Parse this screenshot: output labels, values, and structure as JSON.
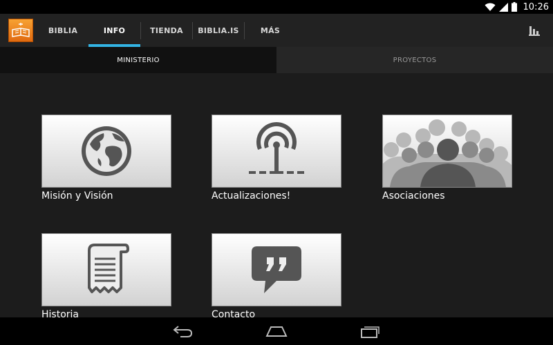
{
  "status": {
    "time": "10:26"
  },
  "app": {
    "icon": "bible-app-icon",
    "tabs": [
      {
        "label": "BIBLIA",
        "active": false
      },
      {
        "label": "INFO",
        "active": true
      },
      {
        "label": "TIENDA",
        "active": false
      },
      {
        "label": "BIBLIA.IS",
        "active": false
      },
      {
        "label": "MÁS",
        "active": false
      }
    ],
    "overflow_icon": "bar-chart-icon"
  },
  "subtabs": [
    {
      "label": "MINISTERIO",
      "active": true
    },
    {
      "label": "PROYECTOS",
      "active": false
    }
  ],
  "tiles": [
    {
      "label": "Misión y Visión",
      "icon": "globe-icon"
    },
    {
      "label": "Actualizaciones!",
      "icon": "broadcast-icon"
    },
    {
      "label": "Asociaciones",
      "icon": "people-icon"
    },
    {
      "label": "Historia",
      "icon": "scroll-icon"
    },
    {
      "label": "Contacto",
      "icon": "quote-bubble-icon"
    }
  ],
  "nav": {
    "back": "back-icon",
    "home": "home-icon",
    "recents": "recents-icon"
  },
  "colors": {
    "accent": "#33b5e5",
    "app_icon": "#f08a1e"
  }
}
